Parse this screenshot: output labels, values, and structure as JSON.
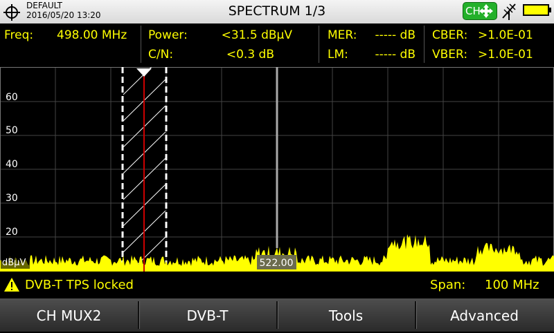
{
  "header": {
    "profile": "DEFAULT",
    "datetime": "2016/05/20 13:20",
    "title": "SPECTRUM 1/3",
    "ch_button": "CH"
  },
  "measurements": {
    "freq_label": "Freq:",
    "freq_value": "498.00 MHz",
    "power_label": "Power:",
    "power_value": "<31.5 dBµV",
    "cn_label": "C/N:",
    "cn_value": "<0.3 dB",
    "mer_label": "MER:",
    "mer_value": "----- dB",
    "lm_label": "LM:",
    "lm_value": "----- dB",
    "cber_label": "CBER:",
    "cber_value": ">1.0E-01",
    "vber_label": "VBER:",
    "vber_value": ">1.0E-01"
  },
  "spectrum": {
    "unit_label": "dBµV",
    "y_ticks": [
      "60",
      "50",
      "40",
      "30",
      "20"
    ],
    "center_label": "522.00",
    "colors": {
      "trace": "#ffff00",
      "grid": "#444444",
      "marker": "#cc0000",
      "text": "#ffff00"
    }
  },
  "status": {
    "message": "DVB-T TPS locked",
    "span_label": "Span:",
    "span_value": "100 MHz"
  },
  "softkeys": [
    "CH MUX2",
    "DVB-T",
    "Tools",
    "Advanced"
  ]
}
